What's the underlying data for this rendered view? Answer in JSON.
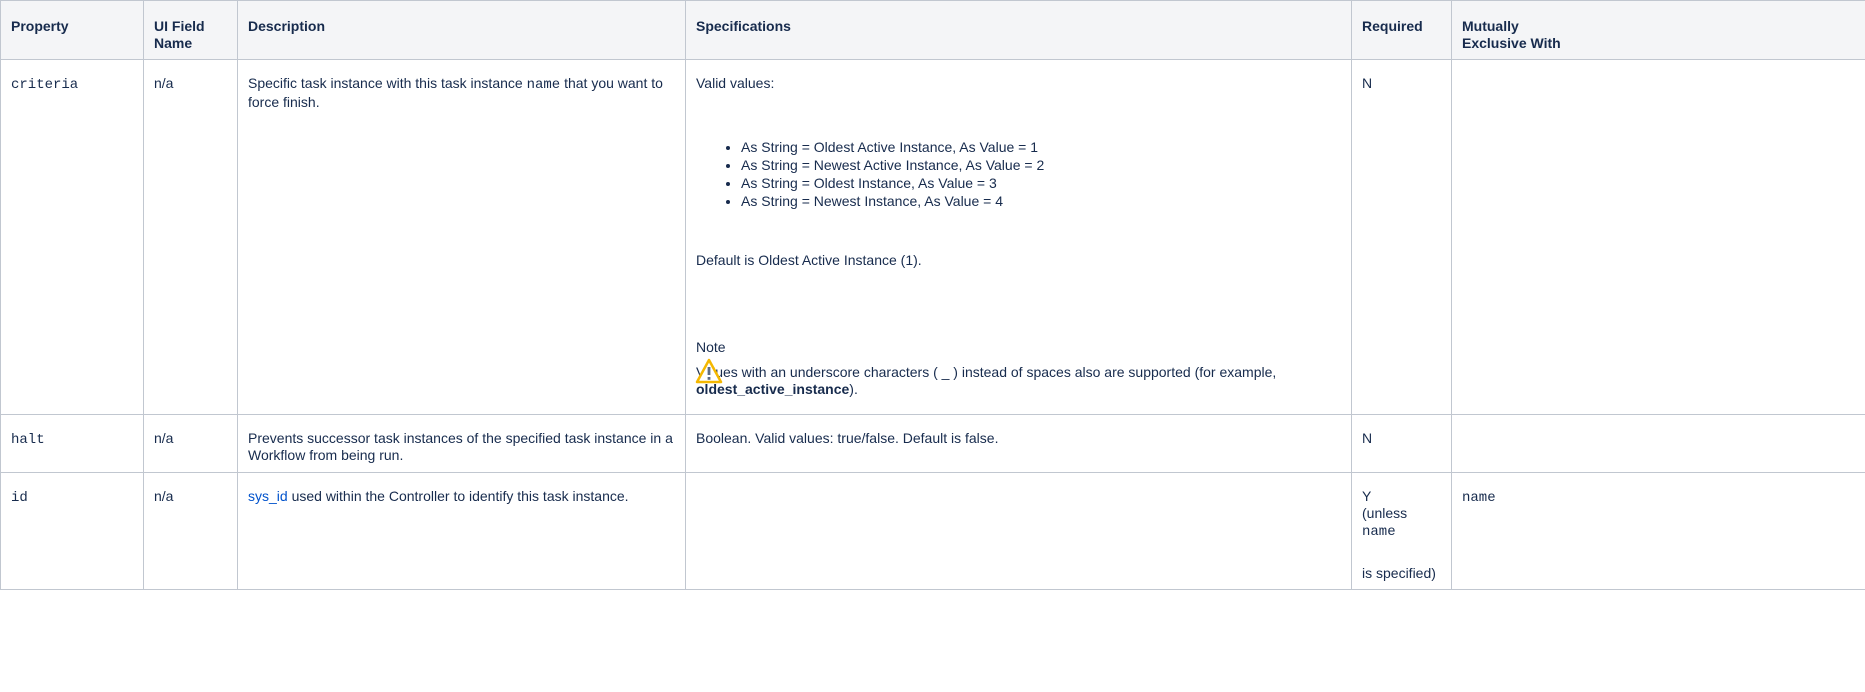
{
  "headers": [
    "Property",
    "UI Field Name",
    "Description",
    "Specifications",
    "Required",
    "Mutually Exclusive With"
  ],
  "rows": {
    "criteria": {
      "property": "criteria",
      "ui_field": "n/a",
      "description_pre": "Specific task instance with this task instance ",
      "description_code": "name",
      "description_post": " that you want to force finish.",
      "spec_intro": "Valid values:",
      "spec_values": [
        "As String = Oldest Active Instance, As Value = 1",
        "As String = Newest Active Instance, As Value = 2",
        "As String = Oldest Instance, As Value = 3",
        "As String = Newest Instance, As Value = 4"
      ],
      "spec_default": "Default is Oldest Active Instance (1).",
      "note_title": "Note",
      "note_text": "Values with an underscore characters ( _ ) instead of spaces also are supported (for example, ",
      "note_bold": "oldest_active_instance",
      "note_end": ").",
      "required": "N",
      "exclusive": ""
    },
    "halt": {
      "property": "halt",
      "ui_field": "n/a",
      "description": "Prevents successor task instances of the specified task instance in a Workflow from being run.",
      "spec": "Boolean. Valid values: true/false. Default is false.",
      "required": "N",
      "exclusive": ""
    },
    "id": {
      "property": "id",
      "ui_field": "n/a",
      "description_link": "sys_id",
      "description_post": " used within the Controller to identify this task instance.",
      "spec": "",
      "required_1": "Y",
      "required_2": "(unless ",
      "required_code": "name",
      "required_3": "is specified)",
      "exclusive": "name"
    }
  },
  "icons": {
    "note": "warning-icon"
  },
  "colors": {
    "header_bg": "#f4f5f7",
    "border": "#c1c7d0",
    "link": "#0052cc",
    "warning": "#f5b800"
  }
}
